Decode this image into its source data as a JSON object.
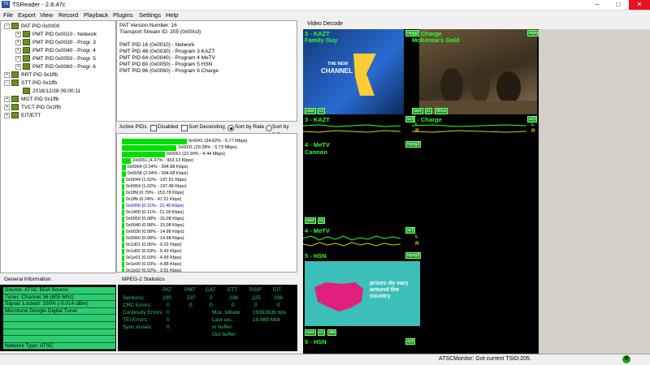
{
  "window": {
    "title": "TSReader - 2.8.47c",
    "app_icon": "TS",
    "min": "–",
    "max": "□",
    "close": "✕"
  },
  "menu": [
    "File",
    "Export",
    "View",
    "Record",
    "Playback",
    "Plugins",
    "Settings",
    "Help"
  ],
  "tree": [
    {
      "label": "PAT PID 0x0000",
      "indent": 0,
      "exp": "−"
    },
    {
      "label": "PMT PID 0x0010 - Network",
      "indent": 1,
      "exp": "+"
    },
    {
      "label": "PMT PID 0x0030 - Progr. 3",
      "indent": 1,
      "exp": "+"
    },
    {
      "label": "PMT PID 0x0040 - Progr. 4",
      "indent": 1,
      "exp": "+"
    },
    {
      "label": "PMT PID 0x0050 - Progr. 5",
      "indent": 1,
      "exp": "+"
    },
    {
      "label": "PMT PID 0x0060 - Progr. 6",
      "indent": 1,
      "exp": "+"
    },
    {
      "label": "RRT PID 0x1ffb",
      "indent": 0,
      "exp": "+"
    },
    {
      "label": "STT PID 0x1ffb",
      "indent": 0,
      "exp": "−"
    },
    {
      "label": "2018/12/28 09:00:11",
      "indent": 1,
      "exp": ""
    },
    {
      "label": "MGT PID 0x1ffb",
      "indent": 0,
      "exp": "+"
    },
    {
      "label": "TVCT PID 0x1ffb",
      "indent": 0,
      "exp": "+"
    },
    {
      "label": "EIT/ETT",
      "indent": 0,
      "exp": "+"
    }
  ],
  "pat_info": [
    "PAT Version Number: 16",
    "Transport Stream ID: 205 (0x00cd)",
    "",
    "PMT PID 16 (0x0010) - Network",
    "PMT PID 48 (0x0030) - Program 3 KAZT",
    "PMT PID 64 (0x0040) - Program 4 MeTV",
    "PMT PID 80 (0x0050) - Program 5 HSN",
    "PMT PID 96 (0x0060) - Program 6 Charge"
  ],
  "active_pids": {
    "title": "Active PIDs",
    "disabled_label": "Disabled",
    "sort_desc_label": "Sort Decending",
    "sort_rate_label": "Sort by Rate",
    "sort_pid_label": "Sort by PID",
    "rows": [
      {
        "text": "0x0041 (34.82% - 6.77 Mbps)",
        "pct": 34.82
      },
      {
        "text": "0x0031 (29.28% - 5.73 Mbps)",
        "pct": 29.28
      },
      {
        "text": "0x0061 (22.90% - 4.44 Mbps)",
        "pct": 22.9
      },
      {
        "text": "0x0051 (4.97% - 963.13 Kbps)",
        "pct": 4.97
      },
      {
        "text": "0x0064 (2.04% - 394.88 Kbps)",
        "pct": 2.04
      },
      {
        "text": "0x0034 (2.04% - 394.68 Kbps)",
        "pct": 2.04
      },
      {
        "text": "0x0044 (1.02% - 197.51 Kbps)",
        "pct": 1.02
      },
      {
        "text": "0x0054 (1.02% - 197.48 Kbps)",
        "pct": 1.02
      },
      {
        "text": "0x1ffd (0.79% - 153.78 Kbps)",
        "pct": 0.79
      },
      {
        "text": "0x1ffb (0.24% - 47.21 Kbps)",
        "pct": 0.24
      },
      {
        "text": "0x0000 (0.11% - 21.49 Kbps)",
        "pct": 0.11,
        "highlight": true
      },
      {
        "text": "0x1400 (0.11% - 21.18 Kbps)",
        "pct": 0.11
      },
      {
        "text": "0x0050 (0.08% - 15.08 Kbps)",
        "pct": 0.08
      },
      {
        "text": "0x0040 (0.08% - 15.08 Kbps)",
        "pct": 0.08
      },
      {
        "text": "0x0030 (0.08% - 14.98 Kbps)",
        "pct": 0.08
      },
      {
        "text": "0x0060 (0.08% - 14.98 Kbps)",
        "pct": 0.08
      },
      {
        "text": "0x1d01 (0.05% - 9.22 Kbps)",
        "pct": 0.05
      },
      {
        "text": "0x1d02 (0.03% - 5.43 Kbps)",
        "pct": 0.03
      },
      {
        "text": "0x1e01 (0.03% - 4.99 Kbps)",
        "pct": 0.03
      },
      {
        "text": "0x1e00 (0.03% - 4.88 Kbps)",
        "pct": 0.03
      },
      {
        "text": "0x1e02 (0.02% - 3.91 Kbps)",
        "pct": 0.02
      }
    ]
  },
  "general_info": {
    "title": "General Information",
    "rows": [
      "Source: ATSC BDA Source",
      "Tuner: Channel 36 (605 Mhz)",
      "Signal: Locked: 100% (-0.014 dBm)",
      "Microtune Dongle Digital Tuner",
      "",
      "",
      "",
      "",
      "Network Type: ATSC"
    ]
  },
  "stats": {
    "title": "MPEG-2 Statistics",
    "headers": [
      "PAT",
      "PMT",
      "CAT",
      "ETT",
      "PSIP",
      "EIT"
    ],
    "sections_label": "Sections:",
    "sections": [
      "190",
      "537",
      "0",
      "208",
      "225",
      "208"
    ],
    "crc_label": "CRC Errors:",
    "crc": [
      "0",
      "0",
      "0",
      "0",
      "0",
      "0"
    ],
    "continuity_label": "Continuity Errors:",
    "continuity": "0",
    "tei_label": "TEI Errors:",
    "tei": "0",
    "sync_label": "Sync losses:",
    "sync": "0",
    "mux_label": "Mux. bitrate:",
    "mux": "19392639 bps",
    "last_label": "Last sec.:",
    "last": "19.889 Mbit",
    "inbuf_label": "In buffer:",
    "inbuf": "",
    "outbuf_label": "Out buffer:",
    "outbuf": ""
  },
  "video": {
    "title": "Video Decode",
    "tiles": {
      "t1_top": "3 - KAZT",
      "t1_sub": "Family Guy",
      "t2_top": "6 - Charge",
      "t2_sub": "McKenna's Gold",
      "t3_top": "4 - MeTV",
      "t3_sub": "Cannon",
      "t4_top": "5 - HSN",
      "channel7_a": "THE NEW",
      "channel7_b": "CHANNEL",
      "hsn_banner": "prices do vary around the country",
      "tag_mpeg2": "mpeg2",
      "tag_ac3": "ac3",
      "tag_user": "user",
      "tag_cc": "cc",
      "tag_afd": "afd",
      "tag_dmux": "dmux"
    },
    "audio": [
      {
        "label": "3 - KAZT"
      },
      {
        "label": "6 - Charge"
      },
      {
        "label": "4 - MeTV"
      },
      {
        "label": "5 - HSN"
      }
    ],
    "lr_L": "L",
    "lr_R": "R"
  },
  "status": {
    "text": "ATSCMonitor: Got current TSID:205."
  },
  "colors": {
    "green": "#2eff2e",
    "bar": "#00e000",
    "panel": "#000000"
  }
}
